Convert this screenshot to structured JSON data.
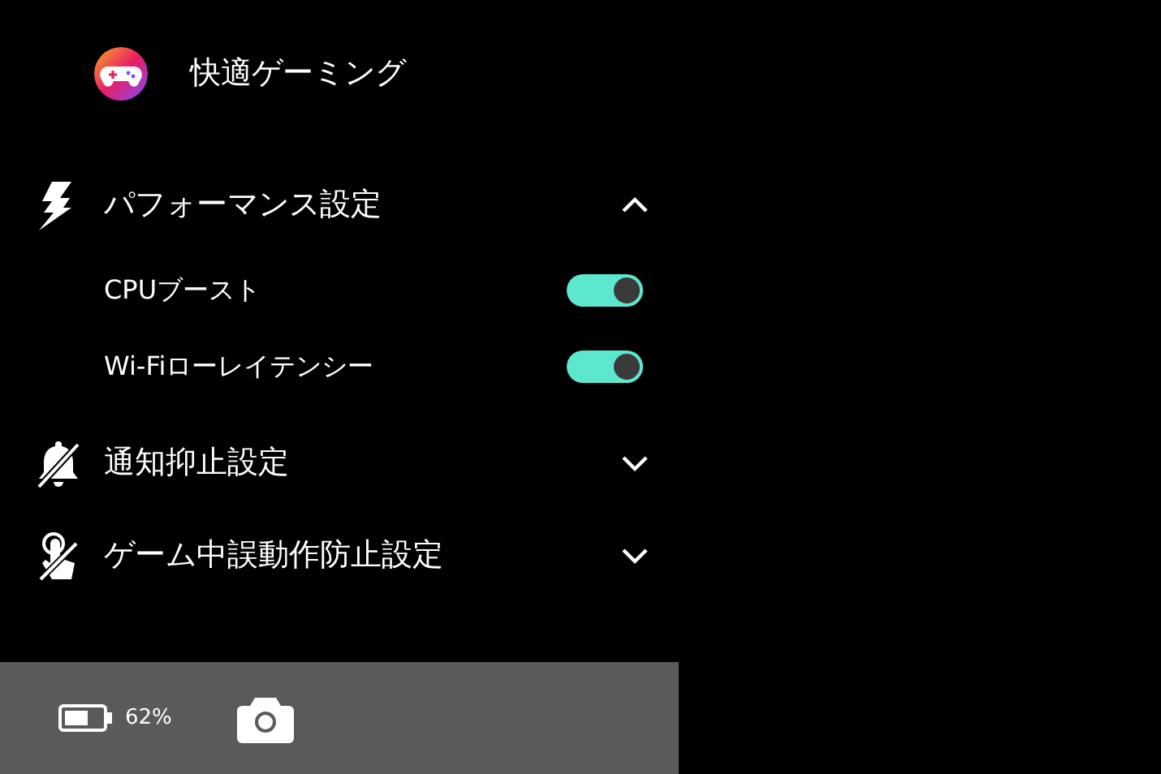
{
  "header": {
    "title": "快適ゲーミング"
  },
  "sections": [
    {
      "kind": "bolt",
      "title": "パフォーマンス設定",
      "expanded": true,
      "items": [
        {
          "label": "CPUブースト",
          "on": true
        },
        {
          "label": "Wi-Fiローレイテンシー",
          "on": true
        }
      ]
    },
    {
      "kind": "bell-off",
      "title": "通知抑止設定",
      "expanded": false
    },
    {
      "kind": "touch-off",
      "title": "ゲーム中誤動作防止設定",
      "expanded": false
    }
  ],
  "status_bar": {
    "battery": "62%"
  }
}
